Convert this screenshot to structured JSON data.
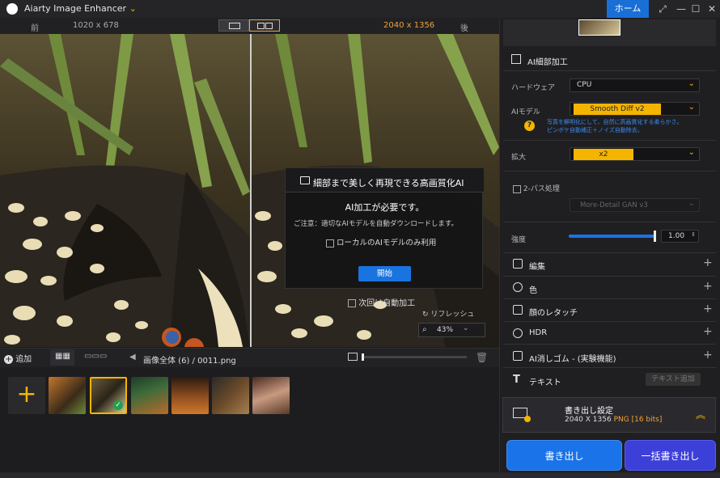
{
  "app": {
    "title": "Aiarty Image Enhancer",
    "home_label": "ホーム"
  },
  "window_controls": {
    "restore": "⤢",
    "minimize": "—",
    "maximize": "☐",
    "close": "✕"
  },
  "compare": {
    "before_label": "前",
    "before_size": "1020 x 678",
    "after_size": "2040 x 1356",
    "after_label": "後"
  },
  "dialog": {
    "title": "細部まで美しく再現できる高画質化AI",
    "required": "AI加工が必要です。",
    "note": "ご注意：適切なAIモデルを自動ダウンロードします。",
    "local_only": "ローカルのAIモデルのみ利用",
    "start": "開始"
  },
  "overlay": {
    "auto_next": "次回は自動加工",
    "refresh": "リフレッシュ",
    "zoom": "43%"
  },
  "filmstrip": {
    "add_label": "追加",
    "scope": "画像全体 (6)",
    "separator": "/",
    "filename": "0011.png",
    "add_tile": "+",
    "count": 6
  },
  "panel": {
    "detail_title": "AI細部加工",
    "hardware_label": "ハードウェア",
    "hardware_value": "CPU",
    "model_label": "AIモデル",
    "model_value": "Smooth Diff  v2",
    "model_desc_1": "写真を鮮明化にして、自然に高画質化する柔らかさ。",
    "model_desc_2": "ピンボケ自動補正＋ノイズ自動除去。",
    "help_icon": "?",
    "scale_label": "拡大",
    "scale_value": "x2",
    "twopass_label": "2-パス処理",
    "twopass_model": "More-Detail GAN  v3",
    "strength_label": "強度",
    "strength_value": "1.00",
    "strength_fraction": 0.99,
    "sections": [
      "編集",
      "色",
      "顔のレタッチ",
      "HDR",
      "AI消しゴム - (実験機能)",
      "テキスト"
    ],
    "text_add": "テキスト追加",
    "export_settings_title": "書き出し設定",
    "export_size": "2040 X 1356",
    "export_format": "PNG",
    "export_bits": "[16 bits]",
    "export_btn": "書き出し",
    "batch_btn": "一括書き出し"
  },
  "colors": {
    "accent": "#1a6fd6",
    "yellow": "#f4b400",
    "orange": "#f0a23a",
    "batch": "#3d3fd9"
  }
}
